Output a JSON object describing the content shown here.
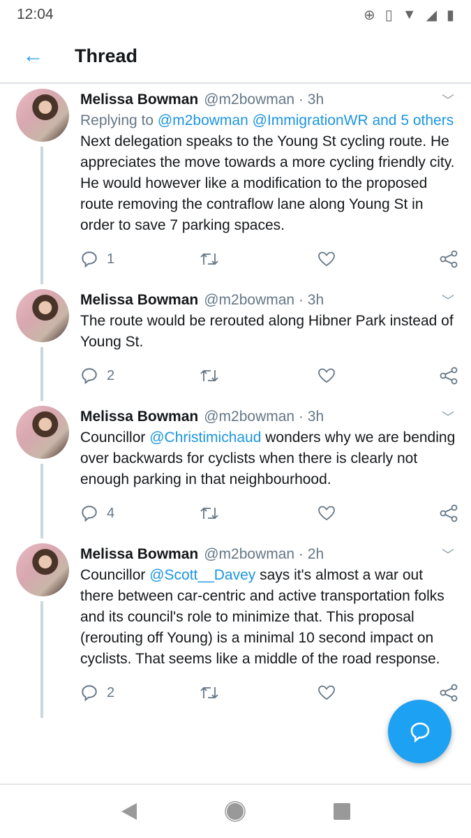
{
  "status_bar": {
    "time": "12:04",
    "icons": [
      "data-saver-icon",
      "vibrate-icon",
      "wifi-icon",
      "signal-icon",
      "battery-icon"
    ]
  },
  "header": {
    "title": "Thread"
  },
  "tweets": [
    {
      "name": "Melissa Bowman",
      "handle": "@m2bowman · 3h",
      "replying_prefix": "Replying to ",
      "replying_links": "@m2bowman @ImmigrationWR and 5 others",
      "text_before": "Next delegation speaks to the Young St cycling route. He appreciates the move towards a more cycling friendly city. He would however like a modification to the proposed route removing the contraflow lane along Young St in order to save 7 parking spaces.",
      "mention": "",
      "text_after": "",
      "replies": "1"
    },
    {
      "name": "Melissa Bowman",
      "handle": "@m2bowman · 3h",
      "text_before": "The route would be rerouted along Hibner Park instead of Young St.",
      "mention": "",
      "text_after": "",
      "replies": "2"
    },
    {
      "name": "Melissa Bowman",
      "handle": "@m2bowman · 3h",
      "text_before": "Councillor ",
      "mention": "@Christimichaud",
      "text_after": " wonders why we are bending over backwards for cyclists when there is clearly not enough parking in that neighbourhood.",
      "replies": "4"
    },
    {
      "name": "Melissa Bowman",
      "handle": "@m2bowman · 2h",
      "text_before": "Councillor ",
      "mention": "@Scott__Davey",
      "text_after": " says it's almost a war out there between car-centric and active transportation folks and its council's role to minimize that. This proposal (rerouting off Young) is a minimal 10 second impact on cyclists. That seems like a middle of the road response.",
      "replies": "2"
    }
  ],
  "colors": {
    "accent": "#1da1f2",
    "muted": "#657786",
    "thread_line": "#ccd6dd"
  }
}
